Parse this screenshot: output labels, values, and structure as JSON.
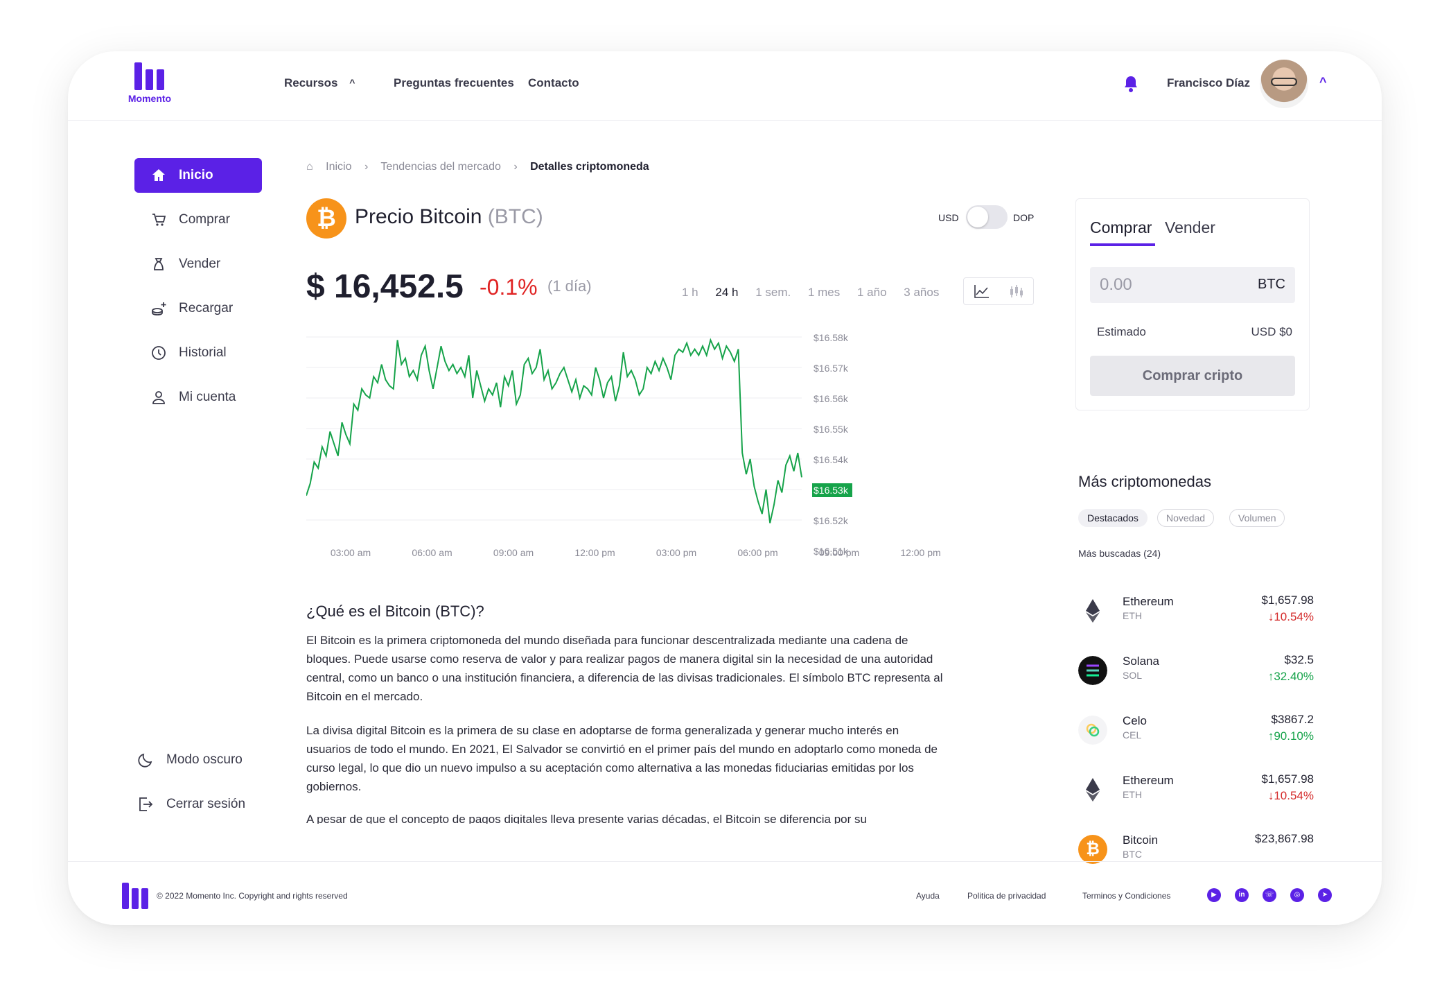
{
  "header": {
    "logo_text": "Momento",
    "nav": [
      {
        "label": "Recursos"
      },
      {
        "label": "Preguntas frecuentes"
      },
      {
        "label": "Contacto"
      }
    ],
    "user_name": "Francisco Díaz"
  },
  "sidebar": {
    "items": [
      {
        "label": "Inicio",
        "icon": "home-icon",
        "active": true
      },
      {
        "label": "Comprar",
        "icon": "cart-icon"
      },
      {
        "label": "Vender",
        "icon": "sell-bag-icon"
      },
      {
        "label": "Recargar",
        "icon": "coins-plus-icon"
      },
      {
        "label": "Historial",
        "icon": "clock-icon"
      },
      {
        "label": "Mi cuenta",
        "icon": "user-icon"
      }
    ],
    "bottom": [
      {
        "label": "Modo oscuro",
        "icon": "moon-icon"
      },
      {
        "label": "Cerrar sesión",
        "icon": "logout-icon"
      }
    ]
  },
  "breadcrumb": {
    "items": [
      "Inicio",
      "Tendencias del mercado",
      "Detalles criptomoneda"
    ]
  },
  "coin": {
    "title": "Precio Bitcoin",
    "symbol": "(BTC)",
    "currency_left": "USD",
    "currency_right": "DOP",
    "price": "$ 16,452.5",
    "change": "-0.1%",
    "period": "(1 día)",
    "ranges": [
      "1 h",
      "24 h",
      "1 sem.",
      "1 mes",
      "1 año",
      "3 años"
    ],
    "selected_range": "24 h"
  },
  "chart_data": {
    "type": "line",
    "title": "",
    "xlabel": "",
    "ylabel": "",
    "x_ticks": [
      "03:00 am",
      "06:00 am",
      "09:00 am",
      "12:00 pm",
      "03:00 pm",
      "06:00 pm",
      "09:00 pm",
      "12:00 pm"
    ],
    "y_ticks": [
      "$16.58k",
      "$16.57k",
      "$16.56k",
      "$16.55k",
      "$16.54k",
      "$16.53k",
      "$16.52k",
      "$16.51k"
    ],
    "highlight_tick": "$16.53k",
    "ylim": [
      16510,
      16580
    ],
    "line_color": "#16a34a",
    "grid": true,
    "values": [
      16528,
      16532,
      16539,
      16537,
      16544,
      16541,
      16549,
      16545,
      16541,
      16552,
      16548,
      16545,
      16558,
      16556,
      16563,
      16561,
      16560,
      16567,
      16565,
      16571,
      16566,
      16564,
      16563,
      16579,
      16571,
      16573,
      16567,
      16569,
      16566,
      16574,
      16577,
      16569,
      16563,
      16570,
      16577,
      16572,
      16569,
      16571,
      16568,
      16570,
      16567,
      16574,
      16560,
      16569,
      16564,
      16559,
      16563,
      16561,
      16565,
      16557,
      16567,
      16564,
      16569,
      16558,
      16561,
      16571,
      16573,
      16568,
      16570,
      16576,
      16566,
      16569,
      16563,
      16565,
      16568,
      16570,
      16566,
      16562,
      16566,
      16560,
      16564,
      16563,
      16561,
      16570,
      16566,
      16560,
      16565,
      16567,
      16559,
      16564,
      16575,
      16567,
      16569,
      16566,
      16561,
      16563,
      16570,
      16568,
      16572,
      16569,
      16573,
      16570,
      16566,
      16574,
      16576,
      16575,
      16578,
      16574,
      16576,
      16574,
      16577,
      16574,
      16579,
      16576,
      16578,
      16573,
      16577,
      16575,
      16572,
      16576,
      16542,
      16535,
      16540,
      16531,
      16526,
      16522,
      16530,
      16519,
      16525,
      16533,
      16529,
      16538,
      16541,
      16536,
      16542,
      16534
    ]
  },
  "article": {
    "heading": "¿Qué es el Bitcoin (BTC)?",
    "paragraphs": [
      "El Bitcoin es la primera criptomoneda del mundo diseñada para funcionar descentralizada mediante una cadena de bloques. Puede usarse como reserva de valor y para realizar pagos de manera digital sin la necesidad de una autoridad central, como un banco o una institución financiera, a diferencia de las divisas tradicionales. El símbolo BTC representa al Bitcoin en el mercado.",
      "La divisa digital Bitcoin es la primera de su clase en adoptarse de forma generalizada y generar mucho interés en usuarios de todo el mundo. En 2021, El Salvador se convirtió en el primer país del mundo en adoptarlo como moneda de curso legal, lo que dio un nuevo impulso a su aceptación como alternativa a las monedas fiduciarias emitidas por los gobiernos.",
      "A pesar de que el concepto de pagos digitales lleva presente varias décadas, el Bitcoin se diferencia por su"
    ]
  },
  "trade": {
    "tab_buy": "Comprar",
    "tab_sell": "Vender",
    "amount": "0.00",
    "unit": "BTC",
    "estimate_label": "Estimado",
    "estimate_value": "USD $0",
    "button": "Comprar cripto"
  },
  "more": {
    "title": "Más criptomonedas",
    "chips": [
      "Destacados",
      "Novedad",
      "Volumen"
    ],
    "most_searched": "Más buscadas",
    "count": "(24)",
    "coins": [
      {
        "name": "Ethereum",
        "symbol": "ETH",
        "price": "$1,657.98",
        "change": "10.54%",
        "dir": "down",
        "arrow": "↓"
      },
      {
        "name": "Solana",
        "symbol": "SOL",
        "price": "$32.5",
        "change": "32.40%",
        "dir": "up",
        "arrow": "↑"
      },
      {
        "name": "Celo",
        "symbol": "CEL",
        "price": "$3867.2",
        "change": "90.10%",
        "dir": "up",
        "arrow": "↑"
      },
      {
        "name": "Ethereum",
        "symbol": "ETH",
        "price": "$1,657.98",
        "change": "10.54%",
        "dir": "down",
        "arrow": "↓"
      },
      {
        "name": "Bitcoin",
        "symbol": "BTC",
        "price": "$23,867.98",
        "change": "",
        "dir": "up",
        "arrow": ""
      }
    ]
  },
  "footer": {
    "copyright": "© 2022 Momento Inc. Copyright and rights reserved",
    "links": [
      "Ayuda",
      "Politica de privacidad",
      "Terminos y Condiciones"
    ],
    "social": [
      "youtube-icon",
      "linkedin-icon",
      "whatsapp-icon",
      "instagram-icon",
      "telegram-icon"
    ]
  },
  "colors": {
    "brand": "#5b21e6",
    "positive": "#16a34a",
    "negative": "#d42a2a"
  }
}
